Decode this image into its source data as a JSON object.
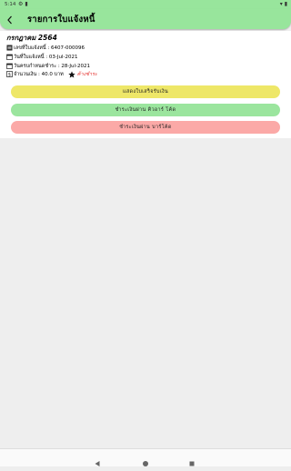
{
  "status_bar": {
    "time": "5:14"
  },
  "app_bar": {
    "title": "รายการใบแจ้งหนี้"
  },
  "invoice": {
    "month": "กรกฎาคม 2564",
    "number": "เลขที่ใบแจ้งหนี้ : 6407-000096",
    "issue_date": "วันที่ใบแจ้งหนี้ : 03-Jul-2021",
    "due_date": "วันครบกำหนดชำระ : 28-Jul-2021",
    "amount": "จำนวนเงิน : 40.0 บาท",
    "status": "ค้างชำระ"
  },
  "buttons": {
    "show_receipt": "แสดงใบเสร็จรับเงิน",
    "pay_qr": "ชำระเงินผ่าน คิวอาร์ โค้ด",
    "pay_barcode": "ชำระเงินผ่าน บาร์โค้ด"
  },
  "colors": {
    "app_bar": "#98e59c",
    "button_yellow": "#eee768",
    "button_green": "#9be59e",
    "button_pink": "#fba9a7",
    "status_red": "#e53935"
  },
  "icons": {
    "back": "arrow-left-icon",
    "invoice_number": "document-icon",
    "issue_date": "calendar-icon",
    "due_date": "calendar-icon",
    "amount": "money-icon",
    "status": "star-icon",
    "nav_back": "triangle-back-icon",
    "nav_home": "circle-home-icon",
    "nav_recents": "square-recents-icon"
  }
}
